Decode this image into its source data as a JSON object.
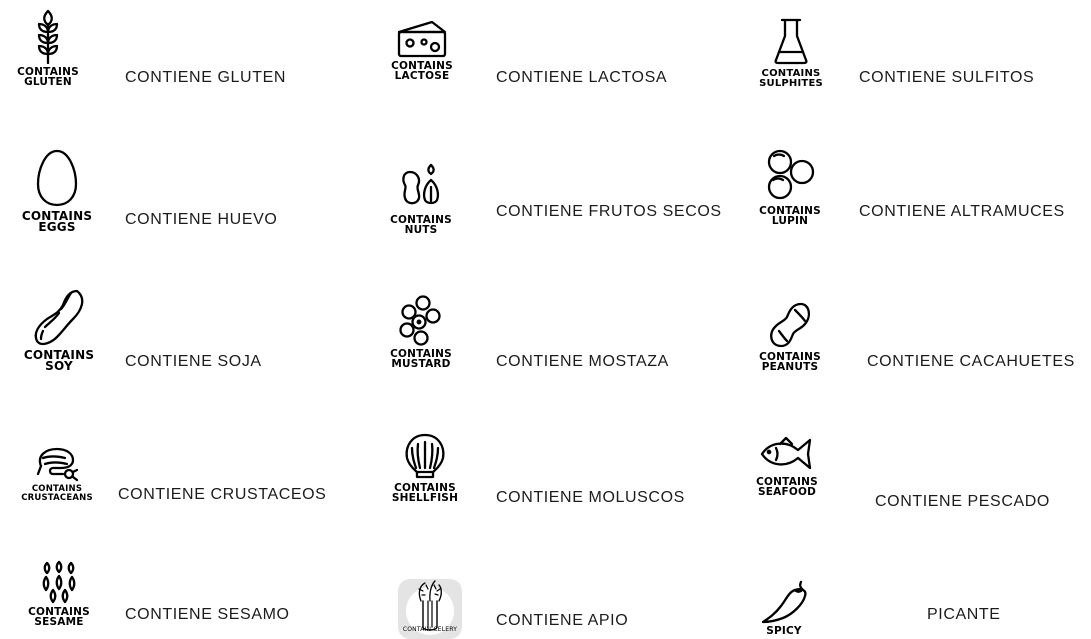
{
  "allergens": [
    {
      "icon": "wheat-icon",
      "badge": [
        "CONTAINS",
        "GLUTEN"
      ],
      "label": "CONTIENE GLUTEN"
    },
    {
      "icon": "cheese-icon",
      "badge": [
        "CONTAINS",
        "LACTOSE"
      ],
      "label": "CONTIENE LACTOSA"
    },
    {
      "icon": "flask-icon",
      "badge": [
        "CONTAINS",
        "SULPHITES"
      ],
      "label": "CONTIENE SULFITOS"
    },
    {
      "icon": "egg-icon",
      "badge": [
        "CONTAINS",
        "EGGS"
      ],
      "label": "CONTIENE HUEVO"
    },
    {
      "icon": "nuts-icon",
      "badge": [
        "CONTAINS",
        "NUTS"
      ],
      "label": "CONTIENE FRUTOS SECOS"
    },
    {
      "icon": "lupin-icon",
      "badge": [
        "CONTAINS",
        "LUPIN"
      ],
      "label": "CONTIENE ALTRAMUCES"
    },
    {
      "icon": "soy-icon",
      "badge": [
        "CONTAINS",
        "SOY"
      ],
      "label": "CONTIENE SOJA"
    },
    {
      "icon": "mustard-icon",
      "badge": [
        "CONTAINS",
        "MUSTARD"
      ],
      "label": "CONTIENE MOSTAZA"
    },
    {
      "icon": "peanut-icon",
      "badge": [
        "CONTAINS",
        "PEANUTS"
      ],
      "label": "CONTIENE CACAHUETES"
    },
    {
      "icon": "shrimp-icon",
      "badge": [
        "CONTAINS",
        "CRUSTACEANS"
      ],
      "label": "CONTIENE CRUSTACEOS"
    },
    {
      "icon": "shell-icon",
      "badge": [
        "CONTAINS",
        "SHELLFISH"
      ],
      "label": "CONTIENE MOLUSCOS"
    },
    {
      "icon": "fish-icon",
      "badge": [
        "CONTAINS",
        "SEAFOOD"
      ],
      "label": "CONTIENE PESCADO"
    },
    {
      "icon": "sesame-icon",
      "badge": [
        "CONTAINS",
        "SESAME"
      ],
      "label": "CONTIENE SESAMO"
    },
    {
      "icon": "celery-icon",
      "badge": [
        "CONTAIN CELERY"
      ],
      "label": "CONTIENE APIO"
    },
    {
      "icon": "chili-icon",
      "badge": [
        "SPICY"
      ],
      "label": "PICANTE"
    }
  ]
}
